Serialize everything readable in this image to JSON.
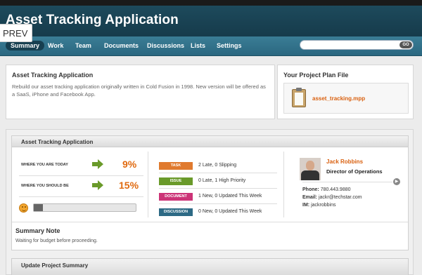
{
  "app": {
    "title": "Asset Tracking Application"
  },
  "prev_label": "PREV",
  "nav": {
    "tabs": [
      {
        "label": "Summary",
        "active": true
      },
      {
        "label": "Work"
      },
      {
        "label": "Team"
      },
      {
        "label": "Documents"
      },
      {
        "label": "Discussions"
      },
      {
        "label": "Lists"
      },
      {
        "label": "Settings"
      }
    ],
    "search": {
      "placeholder": "",
      "button_label": "GO"
    }
  },
  "intro": {
    "title": "Asset Tracking Application",
    "description": "Rebuild our asset tracking application originally written in Cold Fusion in 1998. New version will be offered as a SaaS, iPhone and Facebook App."
  },
  "plan": {
    "title": "Your Project Plan File",
    "file": "asset_tracking.mpp",
    "icon": "clipboard-icon"
  },
  "summary": {
    "title": "Asset Tracking Application",
    "today_label": "WHERE YOU ARE TODAY",
    "today_pct": "9%",
    "should_label": "WHERE YOU SHOULD BE",
    "should_pct": "15%",
    "progress": 0.09,
    "items": [
      {
        "badge": "TASK",
        "color": "#e07a2e",
        "text": "2 Late, 0 Slipping"
      },
      {
        "badge": "ISSUE",
        "color": "#6a9a2a",
        "text": "0 Late, 1 High Priority"
      },
      {
        "badge": "DOCUMENT",
        "color": "#cc3377",
        "text": "1 New, 0 Updated This Week"
      },
      {
        "badge": "DISCUSSION",
        "color": "#2d6a85",
        "text": "0 New, 0 Updated This Week"
      }
    ],
    "contact": {
      "name": "Jack Robbins",
      "title": "Director of Operations",
      "phone_label": "Phone:",
      "phone": "780.443.9880",
      "email_label": "Email:",
      "email": "jackr@techstar.com",
      "im_label": "IM:",
      "im": "jackrobbins"
    },
    "note_title": "Summary Note",
    "note_text": "Waiting for budget before proceeding."
  },
  "update": {
    "title": "Update Project Summary"
  },
  "colors": {
    "header": "#1d4a5c",
    "nav": "#3a7d95",
    "accent": "#e06a10",
    "arrow": "#6a9a2a"
  }
}
